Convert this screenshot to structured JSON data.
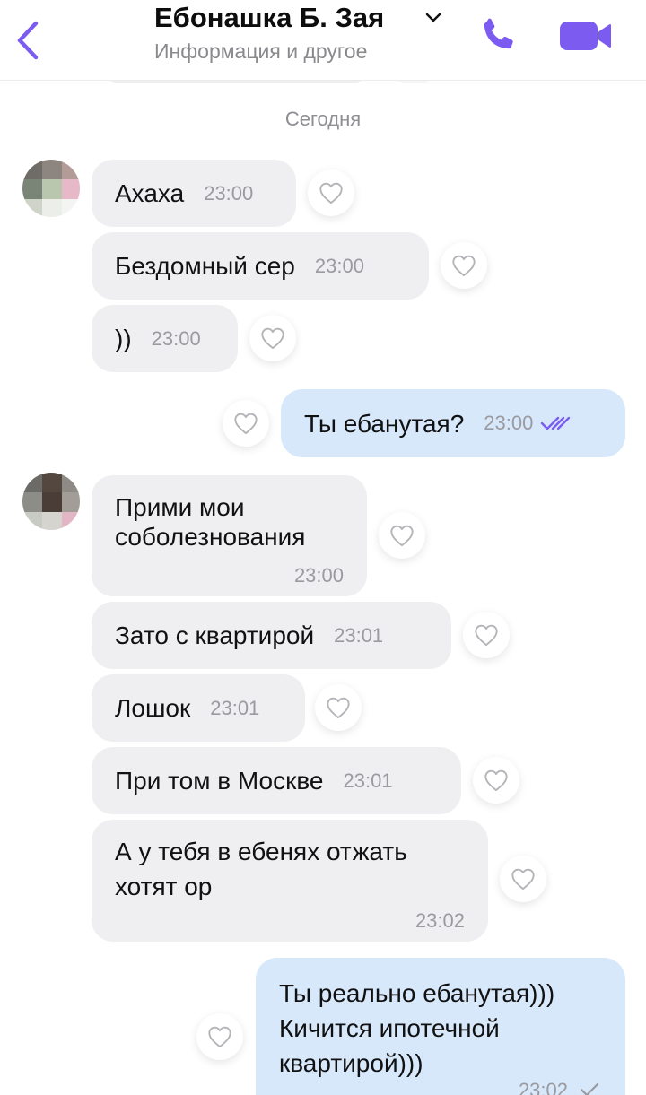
{
  "header": {
    "title": "Ебонашка Б. Зая",
    "subtitle": "Информация и другое"
  },
  "date_separator": "Сегодня",
  "messages": [
    {
      "text": "Ахаха",
      "time": "23:00",
      "direction": "in"
    },
    {
      "text": "Бездомный сер",
      "time": "23:00",
      "direction": "in"
    },
    {
      "text": "))",
      "time": "23:00",
      "direction": "in"
    },
    {
      "text": "Ты ебанутая?",
      "time": "23:00",
      "direction": "out",
      "status": "read"
    },
    {
      "lines": [
        "Прими мои",
        "соболезнования"
      ],
      "time": "23:00",
      "direction": "in"
    },
    {
      "text": "Зато с квартирой",
      "time": "23:01",
      "direction": "in"
    },
    {
      "text": "Лошок",
      "time": "23:01",
      "direction": "in"
    },
    {
      "text": "При том в Москве",
      "time": "23:01",
      "direction": "in"
    },
    {
      "lines": [
        "А у тебя в ебенях отжать",
        "хотят ор"
      ],
      "time": "23:02",
      "direction": "in"
    },
    {
      "lines": [
        "Ты реально ебанутая)))",
        "Кичится ипотечной",
        "квартирой)))"
      ],
      "time": "23:02",
      "direction": "out",
      "status": "delivered"
    }
  ],
  "icons": {
    "back": "chevron-left-icon",
    "call": "phone-icon",
    "video": "video-camera-icon",
    "like": "heart-outline-icon",
    "read": "double-check-icon",
    "delivered": "check-icon"
  },
  "colors": {
    "accent": "#7c5cf0",
    "incoming_bubble": "#efeff1",
    "outgoing_bubble": "#d7e8fb",
    "time_text": "#9a9aa0"
  }
}
